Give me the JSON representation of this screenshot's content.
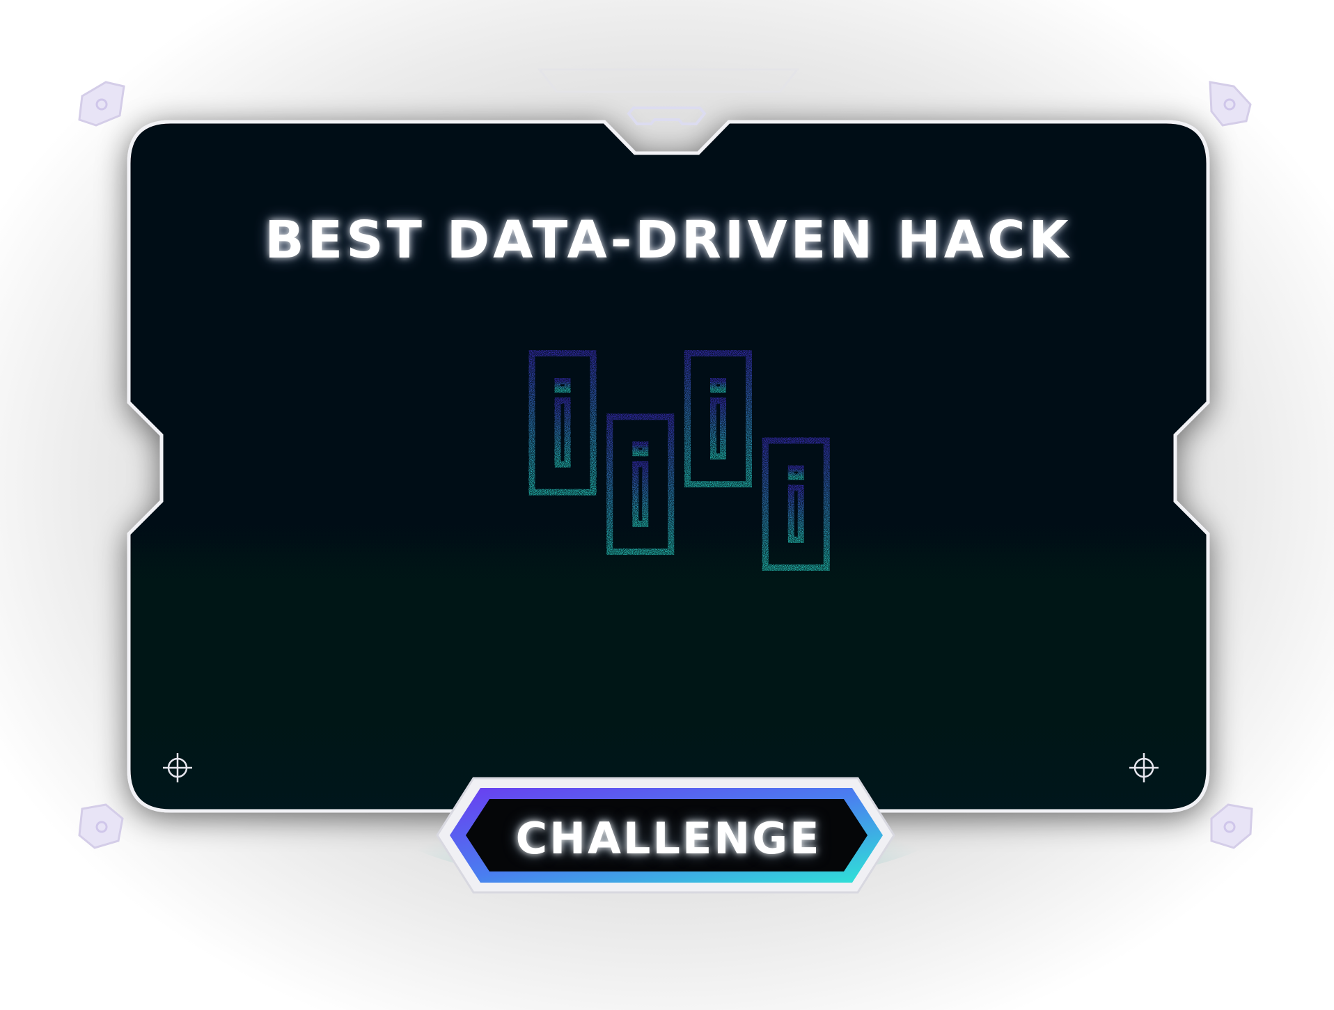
{
  "badge": {
    "title": "BEST DATA-DRIVEN HACK",
    "ribbon_label": "CHALLENGE"
  },
  "icons": {
    "emblem": "candlestick-chart-icon",
    "corner_marks": "crosshair-icon",
    "frame_tabs": "bracket-tab-icon"
  },
  "colors": {
    "panel": "#020b12",
    "frame": "#ececf2",
    "gradient_top": "#3b2fbf",
    "gradient_bottom": "#2ad4c8"
  },
  "chart_data": {
    "type": "candlestick",
    "title": "",
    "categories": [
      "",
      "",
      "",
      ""
    ],
    "boxes": [
      {
        "whisker_high": 0.92,
        "box_high": 0.82,
        "box_low": 0.47,
        "whisker_low": 0.4
      },
      {
        "whisker_high": 0.74,
        "box_high": 0.66,
        "box_low": 0.32,
        "whisker_low": 0.25
      },
      {
        "whisker_high": 0.92,
        "box_high": 0.82,
        "box_low": 0.49,
        "whisker_low": 0.42
      },
      {
        "whisker_high": 0.68,
        "box_high": 0.6,
        "box_low": 0.28,
        "whisker_low": 0.19
      }
    ],
    "y_ticks": 7,
    "x_ticks": 6,
    "ylim": [
      0,
      1
    ]
  }
}
